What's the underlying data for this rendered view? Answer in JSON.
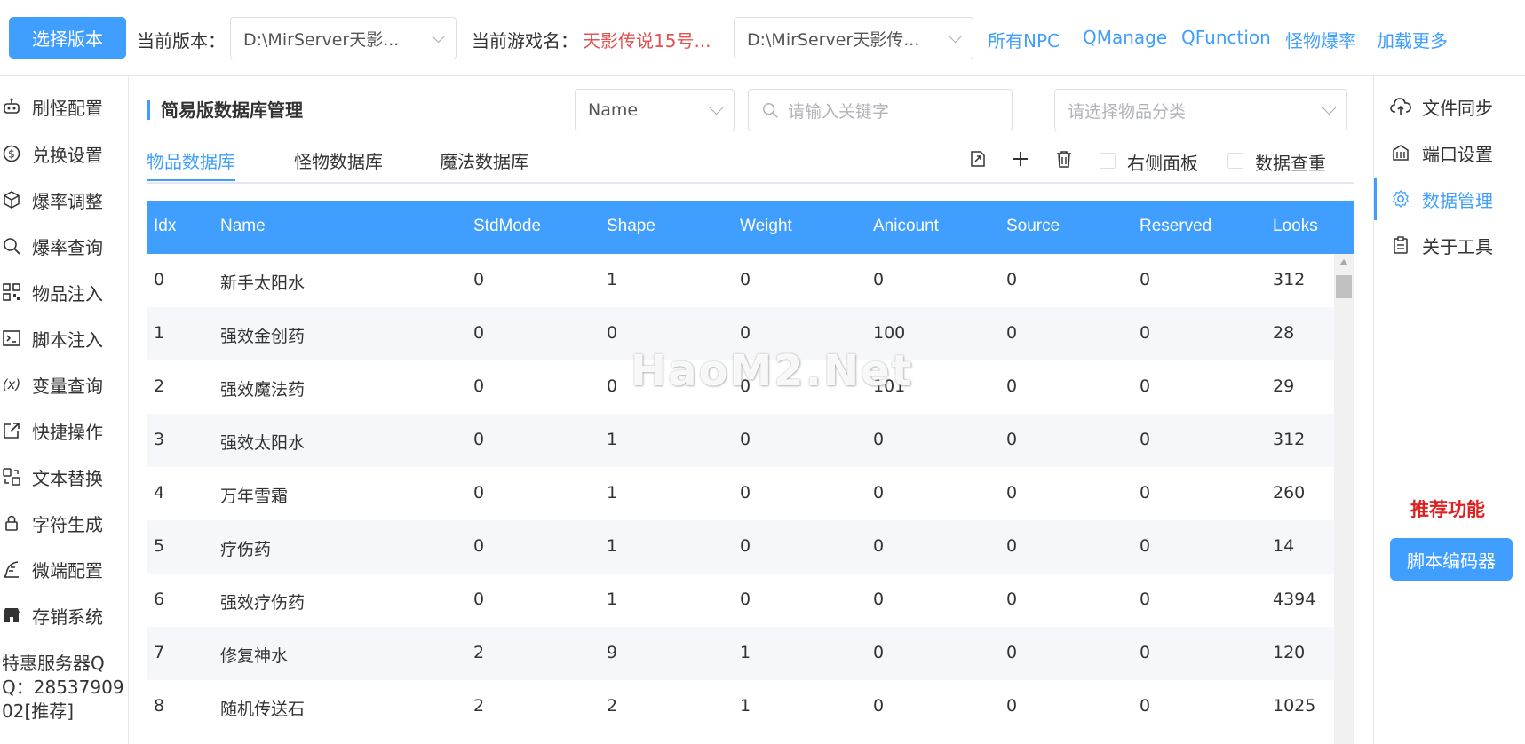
{
  "topbar": {
    "select_version_button": "选择版本",
    "current_version_label": "当前版本：",
    "current_version_value": "D:\\MirServer天影...",
    "current_game_label": "当前游戏名：",
    "current_game_value": "天影传说15号...",
    "game_path_value": "D:\\MirServer天影传...",
    "links": [
      "所有NPC",
      "QManage",
      "QFunction",
      "怪物爆率",
      "加载更多"
    ]
  },
  "left_nav": {
    "items": [
      {
        "label": "刷怪配置",
        "icon": "robot-icon"
      },
      {
        "label": "兑换设置",
        "icon": "dollar-circle-icon"
      },
      {
        "label": "爆率调整",
        "icon": "cube-icon"
      },
      {
        "label": "爆率查询",
        "icon": "search-icon"
      },
      {
        "label": "物品注入",
        "icon": "qrcode-icon"
      },
      {
        "label": "脚本注入",
        "icon": "terminal-icon"
      },
      {
        "label": "变量查询",
        "icon": "variable-icon"
      },
      {
        "label": "快捷操作",
        "icon": "external-link-icon"
      },
      {
        "label": "文本替换",
        "icon": "switch-icon"
      },
      {
        "label": "字符生成",
        "icon": "lock-icon"
      },
      {
        "label": "微端配置",
        "icon": "feather-icon"
      },
      {
        "label": "存销系统",
        "icon": "shop-icon"
      }
    ],
    "promo_text": "特惠服务器QQ：2853790902[推荐]"
  },
  "right_nav": {
    "items": [
      {
        "label": "文件同步",
        "icon": "cloud-upload-icon",
        "active": false
      },
      {
        "label": "端口设置",
        "icon": "building-icon",
        "active": false
      },
      {
        "label": "数据管理",
        "icon": "gear-icon",
        "active": true
      },
      {
        "label": "关于工具",
        "icon": "clipboard-icon",
        "active": false
      }
    ],
    "recommend_title": "推荐功能",
    "recommend_button": "脚本编码器"
  },
  "main": {
    "title": "简易版数据库管理",
    "field_select": "Name",
    "search_placeholder": "请输入关键字",
    "category_placeholder": "请选择物品分类",
    "tabs": [
      {
        "label": "物品数据库",
        "active": true
      },
      {
        "label": "怪物数据库",
        "active": false
      },
      {
        "label": "魔法数据库",
        "active": false
      }
    ],
    "toolbar": {
      "checkbox_right_panel": "右侧面板",
      "checkbox_dedupe": "数据查重"
    }
  },
  "table": {
    "columns": [
      "Idx",
      "Name",
      "StdMode",
      "Shape",
      "Weight",
      "Anicount",
      "Source",
      "Reserved",
      "Looks"
    ],
    "rows": [
      [
        "0",
        "新手太阳水",
        "0",
        "1",
        "0",
        "0",
        "0",
        "0",
        "312"
      ],
      [
        "1",
        "强效金创药",
        "0",
        "0",
        "0",
        "100",
        "0",
        "0",
        "28"
      ],
      [
        "2",
        "强效魔法药",
        "0",
        "0",
        "0",
        "101",
        "0",
        "0",
        "29"
      ],
      [
        "3",
        "强效太阳水",
        "0",
        "1",
        "0",
        "0",
        "0",
        "0",
        "312"
      ],
      [
        "4",
        "万年雪霜",
        "0",
        "1",
        "0",
        "0",
        "0",
        "0",
        "260"
      ],
      [
        "5",
        "疗伤药",
        "0",
        "1",
        "0",
        "0",
        "0",
        "0",
        "14"
      ],
      [
        "6",
        "强效疗伤药",
        "0",
        "1",
        "0",
        "0",
        "0",
        "0",
        "4394"
      ],
      [
        "7",
        "修复神水",
        "2",
        "9",
        "1",
        "0",
        "0",
        "0",
        "120"
      ],
      [
        "8",
        "随机传送石",
        "2",
        "2",
        "1",
        "0",
        "0",
        "0",
        "1025"
      ]
    ]
  },
  "watermark": "HaoM2.Net",
  "colors": {
    "accent": "#409eff",
    "danger": "#e02020",
    "game_name": "#e05454"
  }
}
